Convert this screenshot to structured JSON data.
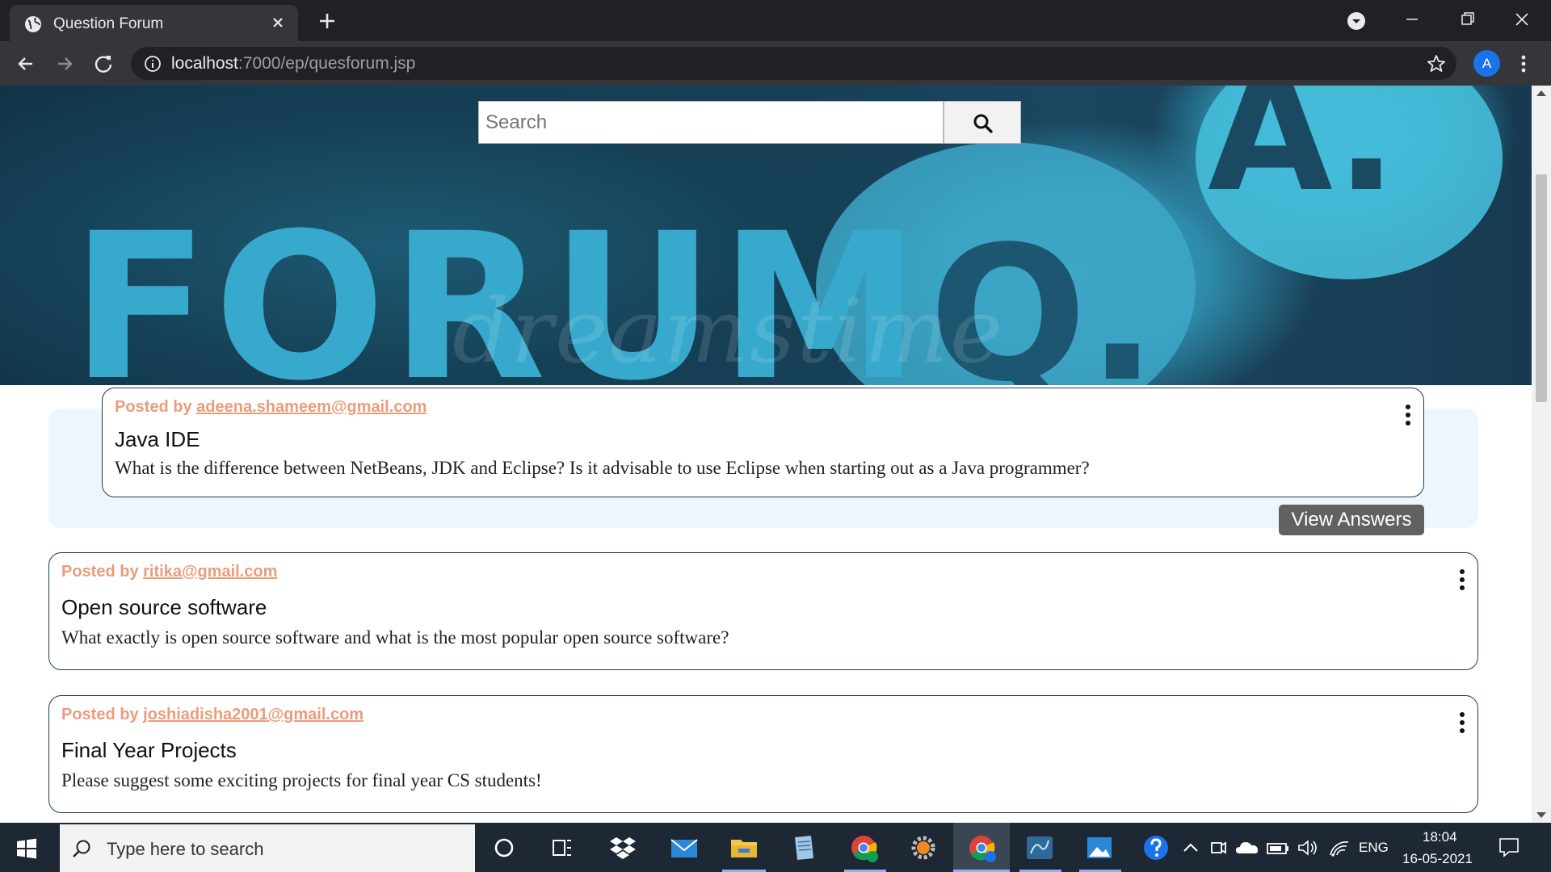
{
  "browser": {
    "tab_title": "Question Forum",
    "url_host": "localhost",
    "url_rest": ":7000/ep/quesforum.jsp",
    "profile_initial": "A"
  },
  "banner": {
    "word": "FORUM",
    "q_letter": "Q.",
    "a_letter": "A.",
    "watermark": "dreamstime"
  },
  "search": {
    "placeholder": "Search"
  },
  "posts": [
    {
      "posted_prefix": "Posted by",
      "author": "adeena.shameem@gmail.com",
      "title": "Java IDE",
      "body": "What is the difference between NetBeans, JDK and Eclipse? Is it advisable to use Eclipse when starting out as a Java programmer?",
      "action_label": "View Answers"
    },
    {
      "posted_prefix": "Posted by",
      "author": "ritika@gmail.com",
      "title": "Open source software",
      "body": "What exactly is open source software and what is the most popular open source software?"
    },
    {
      "posted_prefix": "Posted by",
      "author": "joshiadisha2001@gmail.com",
      "title": "Final Year Projects",
      "body": "Please suggest some exciting projects for final year CS students!"
    }
  ],
  "taskbar": {
    "search_placeholder": "Type here to search",
    "language": "ENG",
    "time": "18:04",
    "date": "16-05-2021"
  },
  "colors": {
    "author": "#eb9c7a",
    "card_border": "#1f3a5a",
    "highlight_bg": "#eef6fd",
    "button_bg": "#616161"
  }
}
